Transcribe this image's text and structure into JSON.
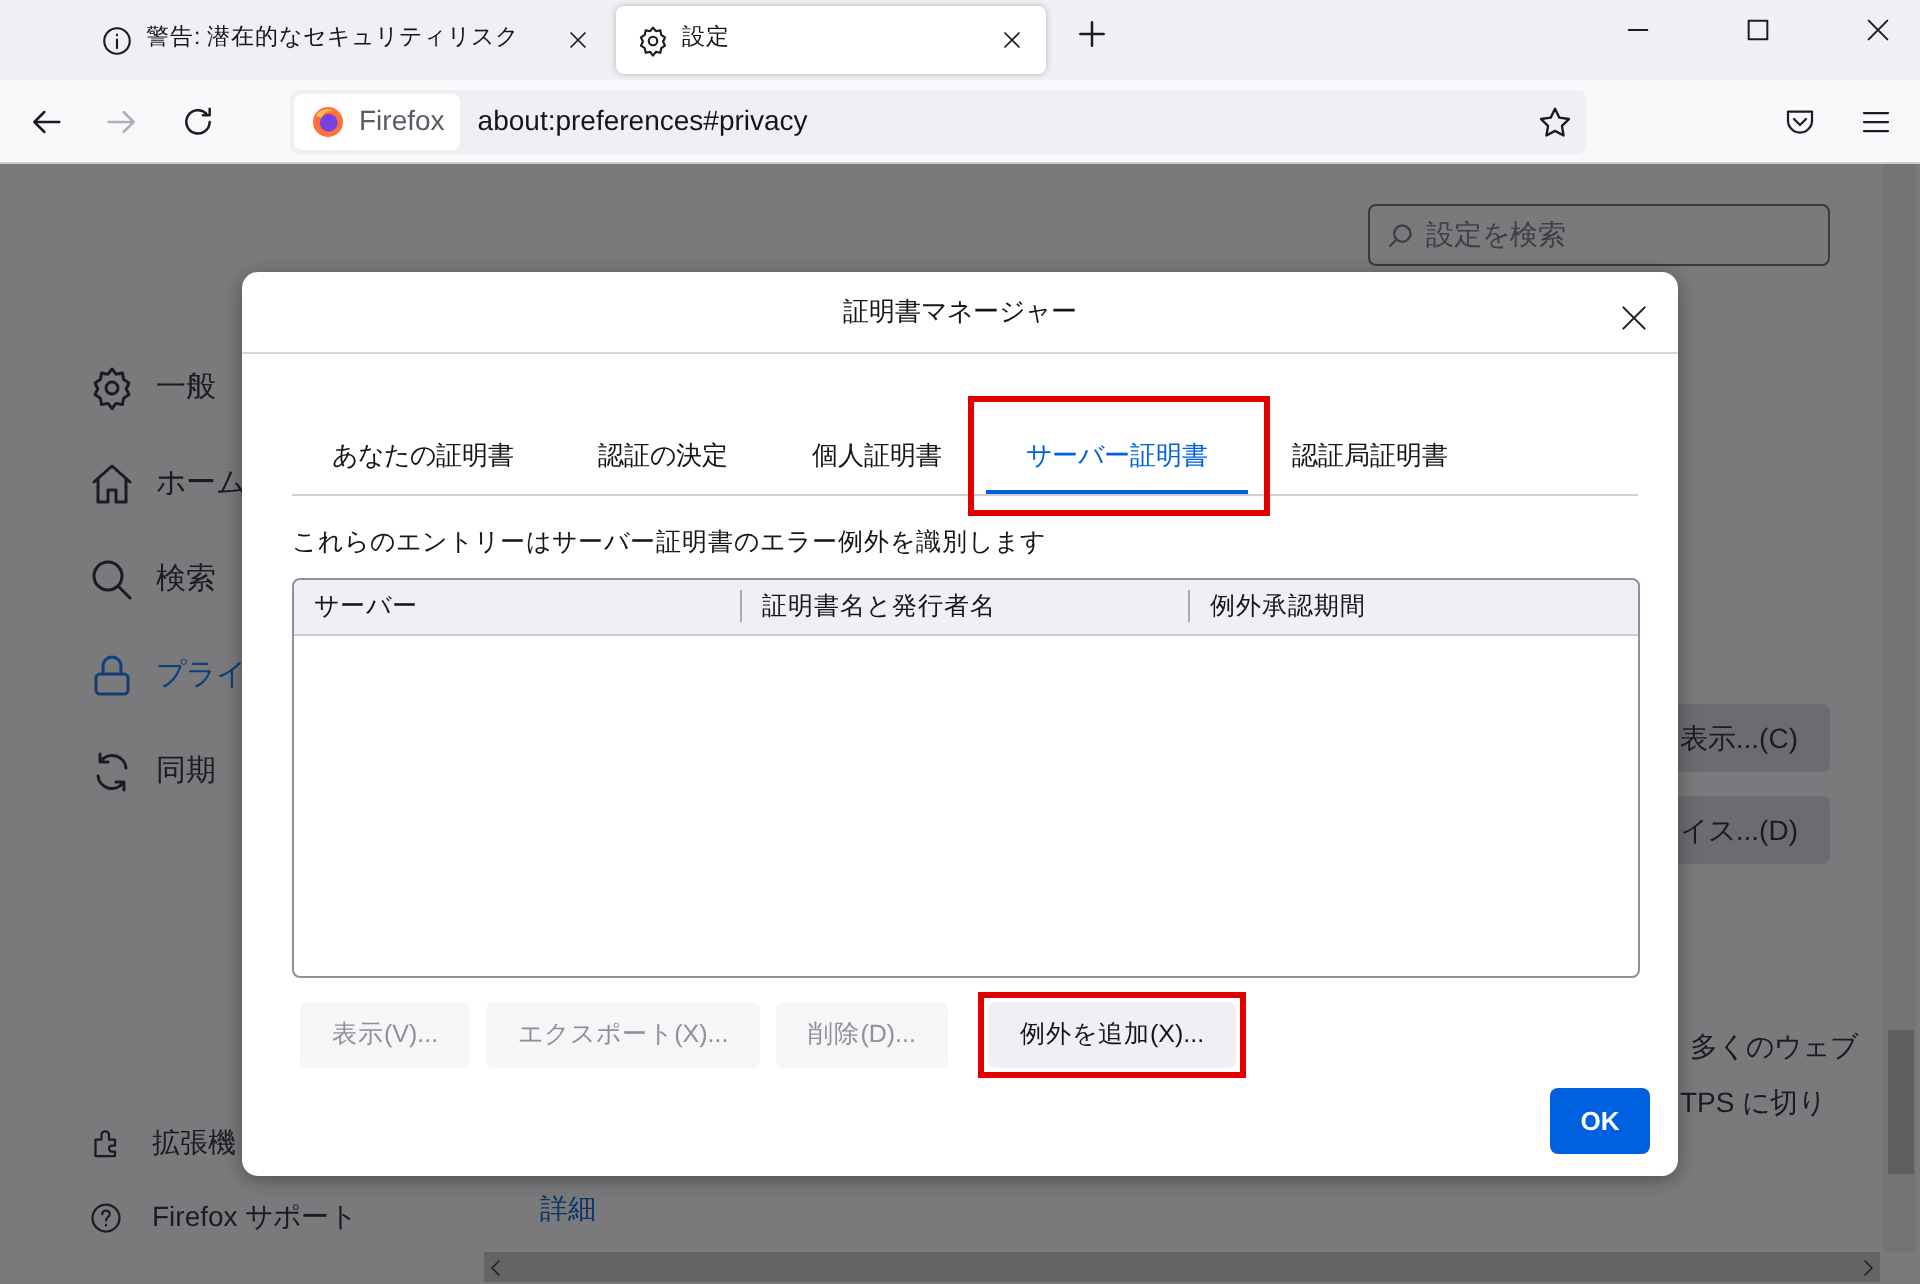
{
  "browser": {
    "tabs": [
      {
        "title": "警告: 潜在的なセキュリティリスク",
        "selected": false
      },
      {
        "title": "設定",
        "selected": true
      }
    ],
    "address": {
      "identity": "Firefox",
      "url": "about:preferences#privacy"
    }
  },
  "page": {
    "search": {
      "placeholder": "設定を検索"
    },
    "sidebar": [
      {
        "label": "一般",
        "selected": false
      },
      {
        "label": "ホーム",
        "selected": false
      },
      {
        "label": "検索",
        "selected": false
      },
      {
        "label": "プライ",
        "selected": true
      },
      {
        "label": "同期",
        "selected": false
      }
    ],
    "sidebar_footer": [
      "拡張機",
      "Firefox サポート"
    ],
    "buttons": [
      "表示...(C)",
      "イス...(D)"
    ],
    "texts": [
      "多くのウェブ",
      "TPS に切り"
    ],
    "link": "詳細"
  },
  "dialog": {
    "title": "証明書マネージャー",
    "tabs": [
      {
        "label": "あなたの証明書",
        "selected": false,
        "highlighted": false
      },
      {
        "label": "認証の決定",
        "selected": false,
        "highlighted": false
      },
      {
        "label": "個人証明書",
        "selected": false,
        "highlighted": false
      },
      {
        "label": "サーバー証明書",
        "selected": true,
        "highlighted": true
      },
      {
        "label": "認証局証明書",
        "selected": false,
        "highlighted": false
      }
    ],
    "description": "これらのエントリーはサーバー証明書のエラー例外を識別します",
    "columns": [
      "サーバー",
      "証明書名と発行者名",
      "例外承認期間"
    ],
    "buttons": [
      {
        "label": "表示(V)...",
        "disabled": true,
        "highlighted": false
      },
      {
        "label": "エクスポート(X)...",
        "disabled": true,
        "highlighted": false
      },
      {
        "label": "削除(D)...",
        "disabled": true,
        "highlighted": false
      },
      {
        "label": "例外を追加(X)...",
        "disabled": false,
        "highlighted": true
      }
    ],
    "ok": "OK"
  }
}
